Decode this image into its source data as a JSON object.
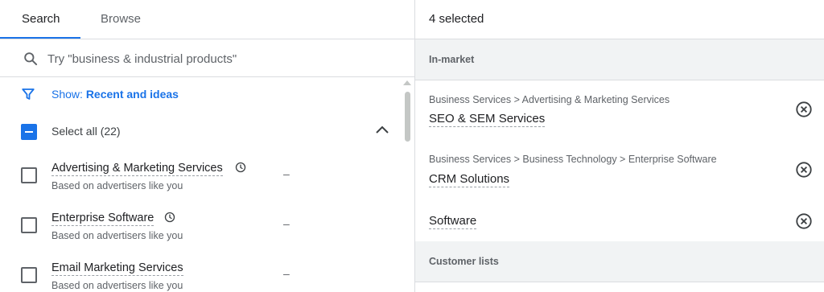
{
  "tabs": [
    {
      "label": "Search",
      "active": true
    },
    {
      "label": "Browse",
      "active": false
    }
  ],
  "search": {
    "placeholder": "Try \"business & industrial products\"",
    "value": ""
  },
  "filter": {
    "prefix": "Show: ",
    "value": "Recent and ideas"
  },
  "select_all": {
    "label": "Select all (22)",
    "state": "indeterminate"
  },
  "results": [
    {
      "title": "Advertising & Marketing Services",
      "subtitle": "Based on advertisers like you",
      "recent": true,
      "metric": "–",
      "checked": false
    },
    {
      "title": "Enterprise Software",
      "subtitle": "Based on advertisers like you",
      "recent": true,
      "metric": "–",
      "checked": false
    },
    {
      "title": "Email Marketing Services",
      "subtitle": "Based on advertisers like you",
      "recent": false,
      "metric": "–",
      "checked": false
    }
  ],
  "selected_panel": {
    "count_label": "4 selected",
    "sections": [
      {
        "title": "In-market",
        "items": [
          {
            "path": "Business Services > Advertising & Marketing Services",
            "name": "SEO & SEM Services"
          },
          {
            "path": "Business Services > Business Technology > Enterprise Software",
            "name": "CRM Solutions"
          },
          {
            "path": "",
            "name": "Software"
          }
        ]
      },
      {
        "title": "Customer lists",
        "items": []
      }
    ]
  },
  "icons": {
    "search": "search-icon",
    "filter": "filter-icon",
    "collapse": "chevron-up-icon",
    "recent": "clock-icon",
    "remove": "remove-circle-icon"
  },
  "colors": {
    "accent": "#1a73e8",
    "section_bg": "#f1f3f4",
    "divider": "#dadce0",
    "muted_text": "#5f6368"
  }
}
